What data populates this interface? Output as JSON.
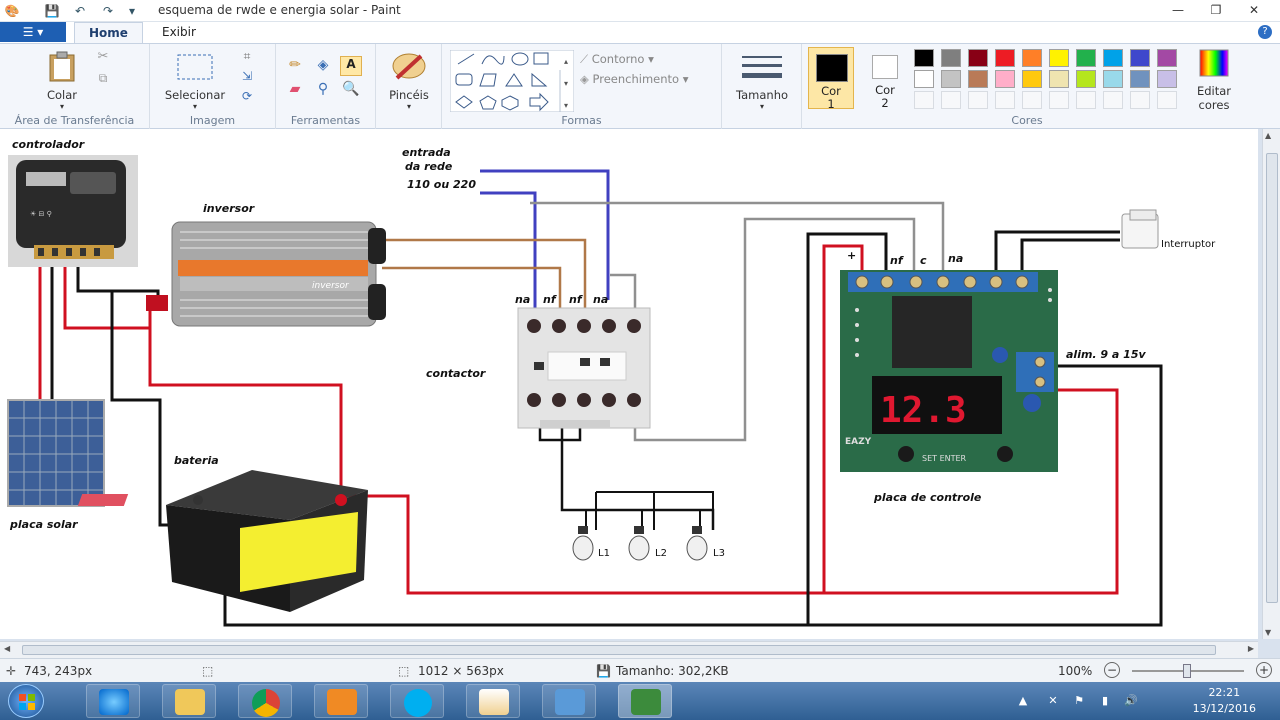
{
  "window": {
    "title": "esquema de rwde e energia solar - Paint",
    "controls": [
      "—",
      "❐",
      "✕"
    ]
  },
  "tabs": {
    "file_label": "☰ ▾",
    "home": "Home",
    "view": "Exibir",
    "help": "?"
  },
  "ribbon": {
    "clipboard": {
      "paste": "Colar",
      "group": "Área de Transferência"
    },
    "image": {
      "select": "Selecionar",
      "group": "Imagem"
    },
    "tools": {
      "group": "Ferramentas"
    },
    "brushes": {
      "label": "Pincéis"
    },
    "shapes": {
      "outline": "Contorno",
      "fill": "Preenchimento",
      "group": "Formas"
    },
    "size": {
      "label": "Tamanho"
    },
    "colors": {
      "color1": "Cor",
      "color1_num": "1",
      "color2": "Cor",
      "color2_num": "2",
      "edit": "Editar",
      "edit2": "cores",
      "group": "Cores",
      "color1_value": "#000000",
      "color2_value": "#ffffff",
      "palette_row1": [
        "#000000",
        "#7f7f7f",
        "#880015",
        "#ed1c24",
        "#ff7f27",
        "#fff200",
        "#22b14c",
        "#00a2e8",
        "#3f48cc",
        "#a349a4"
      ],
      "palette_row2": [
        "#ffffff",
        "#c3c3c3",
        "#b97a57",
        "#ffaec9",
        "#ffc90e",
        "#efe4b0",
        "#b5e61d",
        "#99d9ea",
        "#7092be",
        "#c8bfe7"
      ]
    }
  },
  "diagram": {
    "controlador": "controlador",
    "inversor": "inversor",
    "entrada1": "entrada",
    "entrada2": "da rede",
    "entrada3": "110 ou 220",
    "contactor_terms": [
      "na",
      "nf",
      "nf",
      "na"
    ],
    "contactor": "contactor",
    "relay_terms": [
      "nf",
      "c",
      "na"
    ],
    "plus": "+",
    "alim": "alim. 9 a 15v",
    "interruptor": "Interruptor",
    "bateria": "bateria",
    "placa_solar": "placa solar",
    "placa_controle": "placa de controle",
    "lamps": [
      "L1",
      "L2",
      "L3"
    ],
    "display": "12.3",
    "inverter_brand": "inversor",
    "board_brand": "EAZY",
    "board_btns": "SET  ENTER"
  },
  "status": {
    "cursor": "743, 243px",
    "dims": "1012 × 563px",
    "size": "Tamanho: 302,2KB",
    "zoom": "100%"
  },
  "clock": {
    "time": "22:21",
    "date": "13/12/2016"
  }
}
